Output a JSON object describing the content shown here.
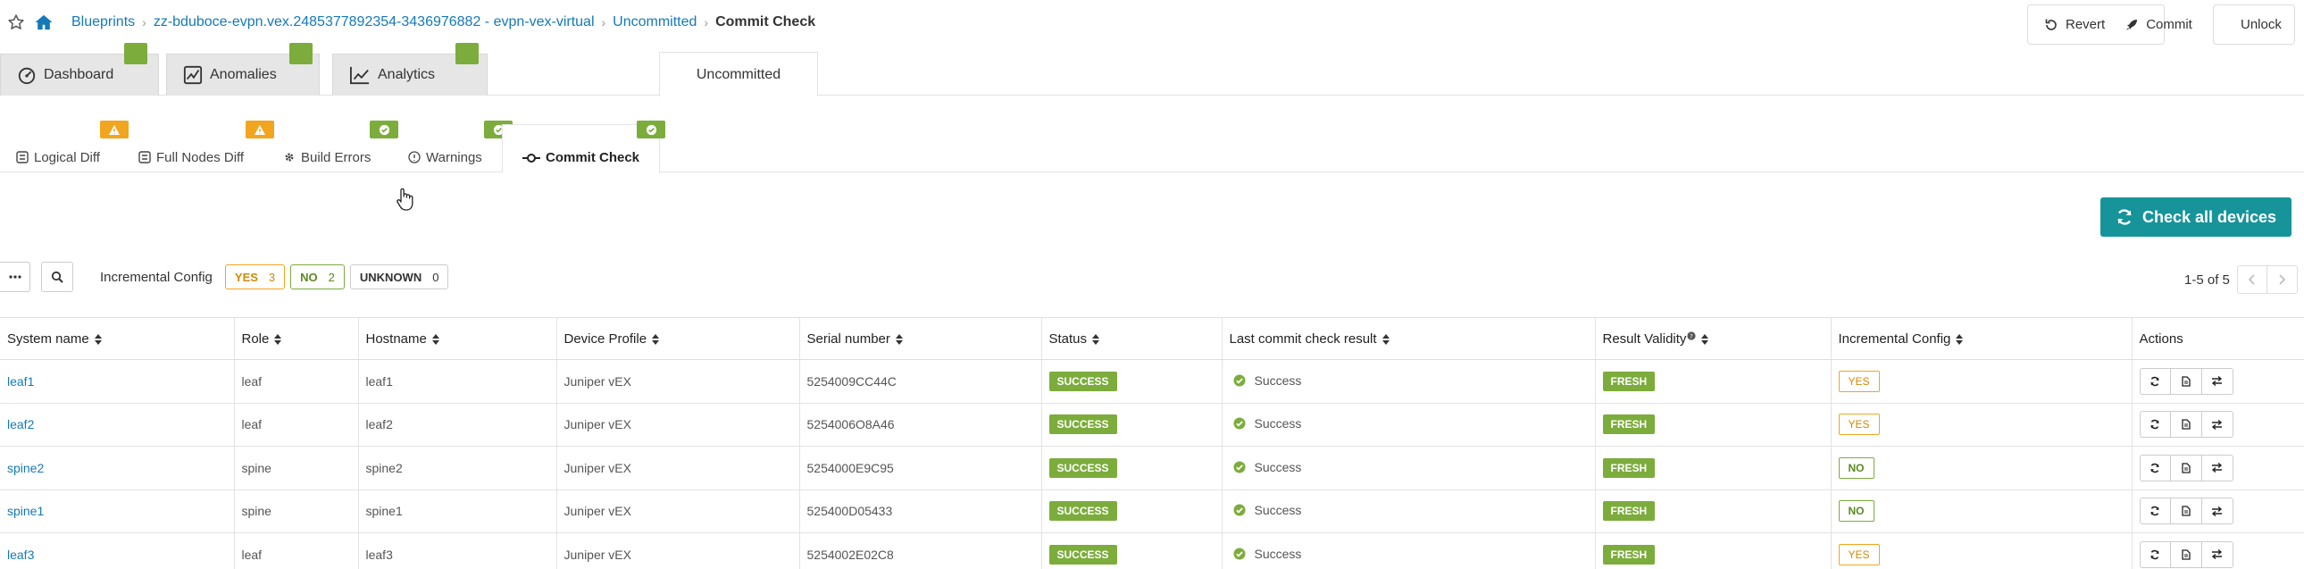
{
  "breadcrumb": {
    "items": [
      "Blueprints",
      "zz-bduboce-evpn.vex.2485377892354-3436976882 - evpn-vex-virtual",
      "Uncommitted"
    ],
    "current": "Commit Check"
  },
  "toolbar": {
    "revert_label": "Revert",
    "commit_label": "Commit",
    "unlock_label": "Unlock"
  },
  "main_tabs": [
    {
      "label": "Dashboard",
      "icon": "dashboard-icon"
    },
    {
      "label": "Anomalies",
      "icon": "anomalies-icon"
    },
    {
      "label": "Analytics",
      "icon": "analytics-icon"
    },
    {
      "label": "Uncommitted",
      "active": true
    }
  ],
  "sub_tabs": [
    {
      "label": "Logical Diff",
      "badge": "warning"
    },
    {
      "label": "Full Nodes Diff",
      "badge": "warning"
    },
    {
      "label": "Build Errors",
      "badge": "ok"
    },
    {
      "label": "Warnings",
      "badge": "ok"
    },
    {
      "label": "Commit Check",
      "badge": "ok",
      "active": true
    }
  ],
  "check_all_label": "Check all devices",
  "filters": {
    "incremental_label": "Incremental Config",
    "yes": {
      "label": "YES",
      "count": "3"
    },
    "no": {
      "label": "NO",
      "count": "2"
    },
    "unknown": {
      "label": "UNKNOWN",
      "count": "0"
    }
  },
  "pager": {
    "text": "1-5 of 5"
  },
  "table": {
    "columns": [
      "System name",
      "Role",
      "Hostname",
      "Device Profile",
      "Serial number",
      "Status",
      "Last commit check result",
      "Result Validity",
      "Incremental Config",
      "Actions"
    ],
    "rows": [
      {
        "system_name": "leaf1",
        "role": "leaf",
        "hostname": "leaf1",
        "profile": "Juniper vEX",
        "serial": "5254009CC44C",
        "status": "SUCCESS",
        "result": "Success",
        "validity": "FRESH",
        "incremental": "YES"
      },
      {
        "system_name": "leaf2",
        "role": "leaf",
        "hostname": "leaf2",
        "profile": "Juniper vEX",
        "serial": "5254006O8A46",
        "status": "SUCCESS",
        "result": "Success",
        "validity": "FRESH",
        "incremental": "YES"
      },
      {
        "system_name": "spine2",
        "role": "spine",
        "hostname": "spine2",
        "profile": "Juniper vEX",
        "serial": "5254000E9C95",
        "status": "SUCCESS",
        "result": "Success",
        "validity": "FRESH",
        "incremental": "NO"
      },
      {
        "system_name": "spine1",
        "role": "spine",
        "hostname": "spine1",
        "profile": "Juniper vEX",
        "serial": "525400D05433",
        "status": "SUCCESS",
        "result": "Success",
        "validity": "FRESH",
        "incremental": "NO"
      },
      {
        "system_name": "leaf3",
        "role": "leaf",
        "hostname": "leaf3",
        "profile": "Juniper vEX",
        "serial": "5254002E02C8",
        "status": "SUCCESS",
        "result": "Success",
        "validity": "FRESH",
        "incremental": "YES"
      }
    ]
  },
  "colors": {
    "accent": "#17949a",
    "success": "#7cac3c",
    "warning": "#f2a51f",
    "link": "#1479b8"
  }
}
